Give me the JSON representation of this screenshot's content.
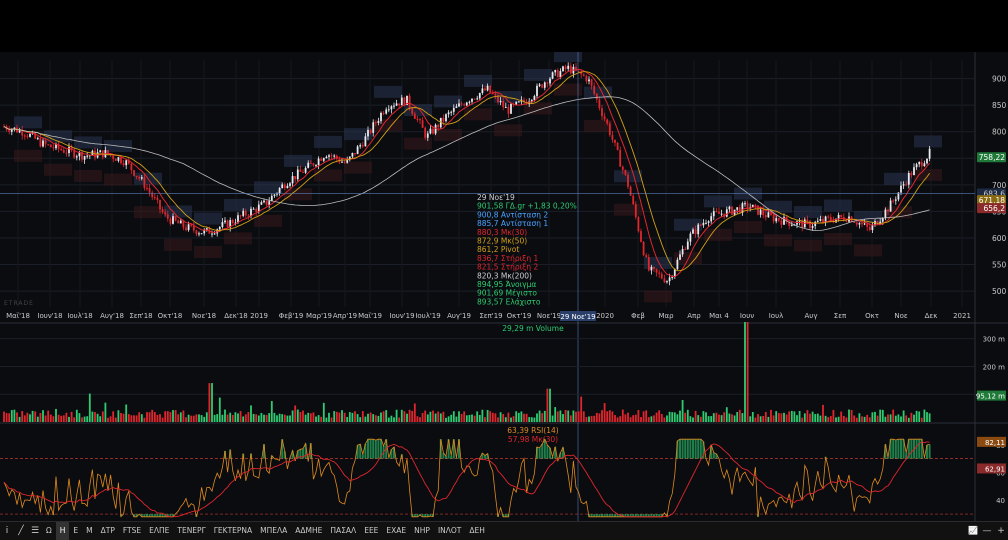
{
  "watermark": "ETRADE",
  "colors": {
    "up": "#2ecc71",
    "down": "#e0262d",
    "background": "#0a0c10",
    "bar_up": "#e8e8ee",
    "bar_down": "#e0262d",
    "ma50": "#d4a017",
    "ma30": "#e0262d",
    "ma200": "#bdbdbd",
    "rsi": "#e08a1e",
    "rsi_ma": "#e0262d",
    "pivot_band": "#2a3550"
  },
  "chart_data": [
    {
      "type": "candlestick",
      "title": "",
      "x_ticks": [
        "Μαϊ'18",
        "Ιουν'18",
        "Ιουλ'18",
        "Αυγ'18",
        "Σεπ'18",
        "Οκτ'18",
        "Νοε'18",
        "Δεκ'18",
        "2019",
        "Φεβ'19",
        "Μαρ'19",
        "Απρ'19",
        "Μαϊ'19",
        "Ιουν'19",
        "Ιουλ'19",
        "Αυγ'19",
        "Σεπ'19",
        "Οκτ'19",
        "Νοε'19",
        "2020",
        "Φεβ",
        "Μαρ",
        "Απρ",
        "Μαι 4",
        "Ιουν",
        "Ιουλ",
        "Αυγ",
        "Σεπ",
        "Οκτ",
        "Νοε",
        "Δεκ",
        "2021"
      ],
      "y_ticks": [
        900,
        850,
        800,
        750,
        700,
        650,
        600,
        550,
        500
      ],
      "ylim": [
        470,
        935
      ],
      "crosshair_label": "29 Νοε'19",
      "close_path": [
        [
          0,
          810
        ],
        [
          1,
          800
        ],
        [
          2,
          775
        ],
        [
          3,
          765
        ],
        [
          4,
          755
        ],
        [
          5,
          760
        ],
        [
          6,
          745
        ],
        [
          7,
          700
        ],
        [
          8,
          640
        ],
        [
          9,
          620
        ],
        [
          10,
          610
        ],
        [
          11,
          625
        ],
        [
          12,
          645
        ],
        [
          13,
          665
        ],
        [
          14,
          705
        ],
        [
          15,
          730
        ],
        [
          16,
          760
        ],
        [
          17,
          740
        ],
        [
          18,
          790
        ],
        [
          19,
          850
        ],
        [
          20,
          860
        ],
        [
          21,
          790
        ],
        [
          22,
          830
        ],
        [
          23,
          860
        ],
        [
          24,
          880
        ],
        [
          25,
          840
        ],
        [
          26,
          860
        ],
        [
          27,
          900
        ],
        [
          28,
          920
        ],
        [
          29,
          900
        ],
        [
          30,
          810
        ],
        [
          31,
          700
        ],
        [
          32,
          540
        ],
        [
          33,
          520
        ],
        [
          34,
          600
        ],
        [
          35,
          640
        ],
        [
          36,
          650
        ],
        [
          37,
          660
        ],
        [
          38,
          640
        ],
        [
          39,
          630
        ],
        [
          40,
          625
        ],
        [
          41,
          635
        ],
        [
          42,
          640
        ],
        [
          43,
          615
        ],
        [
          44,
          660
        ],
        [
          45,
          720
        ],
        [
          46,
          760
        ]
      ],
      "labels": {
        "last_price": "758,22",
        "ma50_last": "671,18",
        "ma30_last": "656,2",
        "level_box": "683,6"
      },
      "info_panel": {
        "date": "29 Νοε'19",
        "price": "901,58 ΓΔ.gr +1,83 0,20%",
        "r2": "900,8 Αντίσταση 2",
        "r1": "885,7 Αντίσταση 1",
        "ma30": "880,3 Μκ(30)",
        "ma50": "872,9 Μκ(50)",
        "pivot": "861,2 Pivot",
        "s1": "836,7 Στήριξη 1",
        "s2": "821,5 Στήριξη 2",
        "ma200": "820,3 Μκ(200)",
        "open": "894,95 Άνοιγμα",
        "high": "901,69 Μέγιστο",
        "low": "893,57 Ελάχιστο"
      }
    },
    {
      "type": "bar",
      "title": "29,29 m Volume",
      "y_ticks": [
        "300 m",
        "200 m",
        "100 m"
      ],
      "last_value_label": "95,12 m"
    },
    {
      "type": "line",
      "title_rsi": "63,39 RSI(14)",
      "title_ma": "57,98 Μκ(30)",
      "y_ticks": [
        "80",
        "60",
        "40"
      ],
      "ylim": [
        25,
        95
      ],
      "threshold_lines": [
        70,
        30
      ],
      "labels": {
        "rsi_last": "82,11",
        "ma_last": "62,91"
      }
    }
  ],
  "toolbar": {
    "items": [
      "Ω",
      "Η",
      "Ε",
      "Μ",
      "ΔΤΡ",
      "FTSE",
      "ΕΛΠΕ",
      "ΤΕΝΕΡΓ",
      "ΓΕΚΤΕΡΝΑ",
      "ΜΠΕΛΑ",
      "ΑΔΜΗΕ",
      "ΠΑΣΑΛ",
      "ΕΕΕ",
      "ΕΧΑΕ",
      "ΝΗΡ",
      "ΙΝΛΟΤ",
      "ΔΕΗ"
    ],
    "active": "Η",
    "left_icons": [
      "info-icon",
      "draw-line-icon",
      "layout-icon"
    ],
    "right_icons": [
      "chart-type-icon",
      "minus-zoom-icon",
      "plus-zoom-icon"
    ],
    "info_glyph": "i",
    "line_glyph": "╱",
    "layout_glyph": "☰",
    "chart_glyph": "📈",
    "minus_glyph": "—",
    "plus_glyph": "+"
  }
}
